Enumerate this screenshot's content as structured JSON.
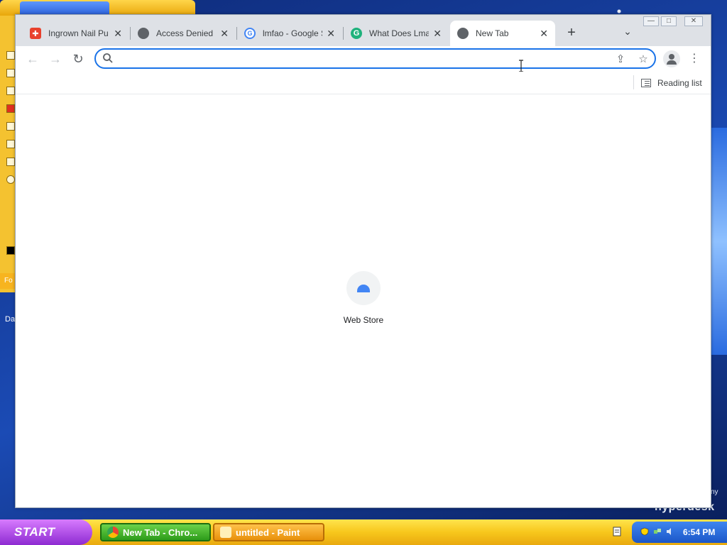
{
  "desktop": {
    "left_label": "Da",
    "watermark": "hyperdesk",
    "corner_label": "ny"
  },
  "paint_window": {
    "side_label": "Fo"
  },
  "browser": {
    "tabs": [
      {
        "title": "Ingrown Nail Pun",
        "favicon": "red-app-icon"
      },
      {
        "title": "Access Denied",
        "favicon": "globe-icon"
      },
      {
        "title": "lmfao - Google Se",
        "favicon": "google-g-icon"
      },
      {
        "title": "What Does Lmao",
        "favicon": "grammarly-icon"
      },
      {
        "title": "New Tab",
        "favicon": "globe-icon"
      }
    ],
    "active_tab_index": 4,
    "tab_close_glyph": "✕",
    "new_tab_glyph": "+",
    "tab_search_glyph": "⌄",
    "window_controls": {
      "minimize": "—",
      "maximize": "□",
      "close": "✕"
    },
    "toolbar": {
      "back_glyph": "←",
      "forward_glyph": "→",
      "reload_glyph": "↻",
      "omnibox_value": "",
      "omnibox_placeholder": "",
      "share_glyph": "⇪",
      "star_glyph": "☆",
      "menu_glyph": "⋮"
    },
    "bookmarks_bar": {
      "reading_list_label": "Reading list"
    },
    "new_tab_page": {
      "shortcuts": [
        {
          "label": "Web Store",
          "icon": "web-store-icon"
        }
      ]
    }
  },
  "taskbar": {
    "start_label": "START",
    "tasks": [
      {
        "label": "New Tab - Chro...",
        "icon": "chrome-icon",
        "active": true
      },
      {
        "label": "untitled - Paint",
        "icon": "paint-icon",
        "active": false
      }
    ],
    "clock": "6:54 PM"
  },
  "colors": {
    "accent": "#1a73e8",
    "tabstrip": "#dee1e6",
    "taskbar": "#f7c71c",
    "start": "#8e2bd1"
  }
}
